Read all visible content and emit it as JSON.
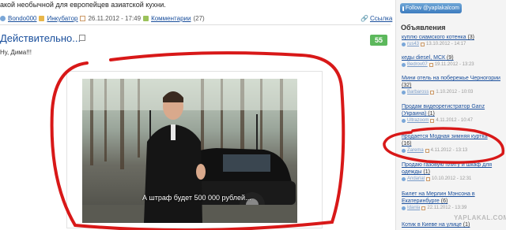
{
  "intro_text": "акой необычной для европейцев азиатской кухни.",
  "meta": {
    "author": "Bondo000",
    "category": "Инкубатор",
    "date": "26.11.2012 - 17:49",
    "comments": "Комментарии",
    "comments_count": "(27)",
    "link": "Ссылка"
  },
  "post": {
    "title": "Действительно...",
    "score": "55",
    "text": "Ну, Дима!!!",
    "caption": "А штраф будет 500 000 рублей..."
  },
  "sidebar": {
    "follow_label": "Follow @yaplakalcom",
    "ads_title": "Объявления",
    "ads": [
      {
        "title": "куплю сиамского котенка",
        "count": "(3)",
        "user": "rus43",
        "date": "13.10.2012 - 14:17"
      },
      {
        "title": "кеды diesel, МСК",
        "count": "(9)",
        "user": "Bedrov07",
        "date": "19.11.2012 - 13:23"
      },
      {
        "title": "Мини отель на побережье Черногории",
        "count": "(32)",
        "user": "Barbaross",
        "date": "1.10.2012 - 10:03"
      },
      {
        "title": "Продам видеорегистратор Ganz (Украина)",
        "count": "(1)",
        "user": "Ultrazoom",
        "date": "4.11.2012 - 10:47"
      },
      {
        "title": "продается Модная зимняя куртка",
        "count": "(16)",
        "user": "Zarema",
        "date": "4.11.2012 - 13:13"
      },
      {
        "title": "Продаю газовую плиту и шкаф для одежды",
        "count": "(1)",
        "user": "Andarial",
        "date": "10.10.2012 - 12:31"
      },
      {
        "title": "Билет на Мерлин Мэнсона в Екатеринбурге",
        "count": "(6)",
        "user": "Idanla",
        "date": "22.11.2012 - 13:39"
      },
      {
        "title": "Котик в Киеве на улице",
        "count": "(1)",
        "user": "",
        "date": ""
      }
    ],
    "watermark": "YAPLAKAL.COM"
  },
  "colors": {
    "link": "#1a4f9c",
    "score_bg": "#5cb85c",
    "twitter": "#3d7cbf",
    "red_marker": "#d81818"
  }
}
